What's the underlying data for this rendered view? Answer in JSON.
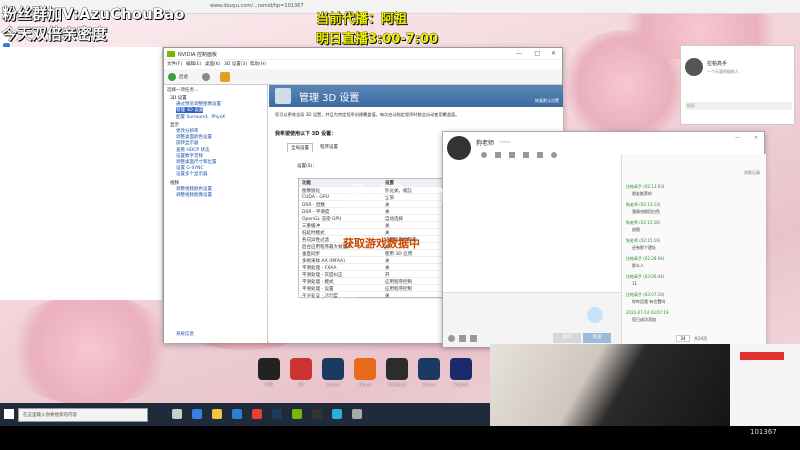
{
  "overlay": {
    "line1": "粉丝群加V:AzuChouBao",
    "line2": "今天双倍亲密度",
    "line3": "当前代播：阿祖",
    "line4": "明日直播3:00-7:00"
  },
  "browser": {
    "url": "www.douyu.com/...ramid/hp=101367"
  },
  "nvidia": {
    "title": "NVIDIA 控制面板",
    "menu": [
      "文件(F)",
      "编辑(E)",
      "桌面(K)",
      "3D 设置(3)",
      "帮助(H)"
    ],
    "back_label": "后退",
    "task_label": "选择一项任务...",
    "tree": [
      {
        "label": "3D 设置",
        "type": "cat"
      },
      {
        "label": "通过预览调整图像设置",
        "type": "item"
      },
      {
        "label": "管理 3D 设置",
        "type": "sel"
      },
      {
        "label": "配置 Surround、PhysX",
        "type": "item"
      },
      {
        "label": "显示",
        "type": "cat"
      },
      {
        "label": "更改分辨率",
        "type": "item"
      },
      {
        "label": "调整桌面颜色设置",
        "type": "item"
      },
      {
        "label": "旋转显示器",
        "type": "item"
      },
      {
        "label": "查看 HDCP 状态",
        "type": "item"
      },
      {
        "label": "设置数字音频",
        "type": "item"
      },
      {
        "label": "调整桌面尺寸和位置",
        "type": "item"
      },
      {
        "label": "设置 G-SYNC",
        "type": "item"
      },
      {
        "label": "设置多个显示器",
        "type": "item"
      },
      {
        "label": "视频",
        "type": "cat"
      },
      {
        "label": "调整视频颜色设置",
        "type": "item"
      },
      {
        "label": "调整视频图像设置",
        "type": "item"
      }
    ],
    "sysinfo": "系统信息",
    "heading": "管理 3D 设置",
    "restore": "恢复默认设置",
    "desc": "您可以更改全局 3D 设置，并且为特定程序创建覆盖值。每次启动指定程序时都会自动使用覆盖值。",
    "prompt": "我希望使用以下 3D 设置：",
    "tabs": [
      "全局设置",
      "程序设置"
    ],
    "settings_label": "设置(S)：",
    "col_feature": "功能",
    "col_setting": "设置",
    "rows": [
      [
        "图像锐化",
        "锐化关，缩放"
      ],
      [
        "CUDA - GPU",
        "全部"
      ],
      [
        "DSR - 因数",
        "关"
      ],
      [
        "DSR - 平滑度",
        "关"
      ],
      [
        "OpenGL 渲染 GPU",
        "自动选择"
      ],
      [
        "三重缓冲",
        "关"
      ],
      [
        "低延时模式",
        "关"
      ],
      [
        "各向异性过滤",
        "应用程序控制的"
      ],
      [
        "后台应用程序最大帧速率",
        "关"
      ],
      [
        "垂直同步",
        "使用 3D 应用"
      ],
      [
        "多帧采样 AA (MFAA)",
        "关"
      ],
      [
        "平滑处理 - FXAA",
        "关"
      ],
      [
        "平滑处理 - 灰度纠正",
        "开"
      ],
      [
        "平滑处理 - 模式",
        "应用程序控制"
      ],
      [
        "平滑处理 - 设置",
        "应用程序控制"
      ],
      [
        "平滑处理 - 透明度",
        "关"
      ]
    ]
  },
  "chat": {
    "name": "狗老师",
    "status": "Online",
    "history_link": "消息记录",
    "messages": [
      {
        "meta": "拉帕高手 (02:13:03)",
        "text": "朋友推荐的"
      },
      {
        "meta": "狗老师 (02:13:13)",
        "text": "我刚也换回白色"
      },
      {
        "meta": "狗老师 (02:15:16)",
        "text": "很稳"
      },
      {
        "meta": "狗老师 (02:15:19)",
        "text": "还有那个遗址"
      },
      {
        "meta": "拉帕高手 (02:28:04)",
        "text": "那么人"
      },
      {
        "meta": "拉帕高手 (03:06:44)",
        "text": "11"
      },
      {
        "meta": "拉帕高手 (03:07:10)",
        "text": "你咋回我 有位置吗"
      },
      {
        "meta": "2022-07-14 03:07:19",
        "text": "您已成功添加"
      }
    ],
    "page_input": "24",
    "page_total": "共24页",
    "send_label": "发送",
    "close_label": "关闭"
  },
  "qq": {
    "name": "拉帕高手",
    "sub": "一个乐观积极的人",
    "search_placeholder": "搜索"
  },
  "desktop": {
    "icons": [
      "OBS",
      "B4",
      "Steam",
      "Game",
      "WeGame",
      "Steam",
      "English"
    ]
  },
  "watermarks": {
    "center": "EsIGame",
    "mid": "获取游戏数据中",
    "bottom": "此提示为 鼠标游戏悬浮窗"
  },
  "taskbar": {
    "search_placeholder": "在这里输入你要搜索的内容"
  },
  "stream": {
    "viewer_id": "101367"
  }
}
